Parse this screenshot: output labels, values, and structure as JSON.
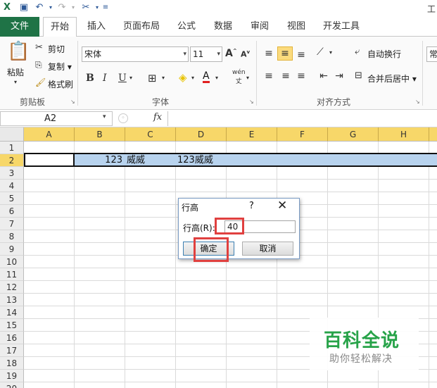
{
  "titlebar": {
    "title": "工"
  },
  "tabs": [
    "文件",
    "开始",
    "插入",
    "页面布局",
    "公式",
    "数据",
    "审阅",
    "视图",
    "开发工具"
  ],
  "ribbon": {
    "clipboard": {
      "paste": "粘贴",
      "cut": "剪切",
      "copy": "复制 ▾",
      "format_painter": "格式刷",
      "group_label": "剪贴板"
    },
    "font": {
      "font_name": "宋体",
      "font_size": "11",
      "bold": "B",
      "italic": "I",
      "underline": "U",
      "group_label": "字体",
      "wen": "wén"
    },
    "alignment": {
      "wrap_text": "自动换行",
      "merge_center": "合并后居中 ▾",
      "group_label": "对齐方式"
    },
    "number": {
      "format": "常"
    }
  },
  "formula_bar": {
    "name_box": "A2",
    "fx": "fx",
    "formula": ""
  },
  "grid": {
    "columns": [
      "A",
      "B",
      "C",
      "D",
      "E",
      "F",
      "G",
      "H"
    ],
    "rows": [
      "1",
      "2",
      "3",
      "4",
      "5",
      "6",
      "7",
      "8",
      "9",
      "10",
      "11",
      "12",
      "13",
      "14",
      "15",
      "16",
      "17",
      "18",
      "19",
      "20"
    ],
    "cells": {
      "B2": "123",
      "C2": "威威",
      "D2": "123威威"
    },
    "selected_row": "2",
    "row_highlight_color": "#b8d3ee",
    "header_highlight_color": "#f7d769"
  },
  "dialog": {
    "title": "行高",
    "help": "?",
    "close": "✕",
    "label": "行高(R):",
    "value": "40",
    "ok": "确定",
    "cancel": "取消",
    "annotation_color": "#e0403f"
  },
  "watermark": {
    "main": "百科全说",
    "sub": "助你轻松解决"
  },
  "colors": {
    "file_tab": "#1f7346",
    "active_button": "#fbdb7d"
  }
}
